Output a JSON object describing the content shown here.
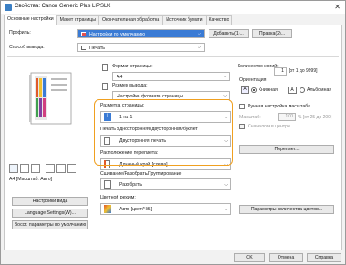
{
  "window": {
    "title": "Свойства: Canon Generic Plus LIPSLX",
    "close_glyph": "✕"
  },
  "tabs": [
    {
      "label": "Основные настройки"
    },
    {
      "label": "Макет страницы"
    },
    {
      "label": "Окончательная обработка"
    },
    {
      "label": "Источник бумаги"
    },
    {
      "label": "Качество"
    }
  ],
  "profile": {
    "label": "Профиль:",
    "value": "Настройки по умолчанию",
    "add_button": "Добавить(1)...",
    "edit_button": "Правка(2)..."
  },
  "output_method": {
    "label": "Способ вывода:",
    "value": "Печать"
  },
  "preview": {
    "caption": "A4 [Масштаб: Авто]"
  },
  "left_buttons": {
    "view_settings": "Настройки вида",
    "language": "Language Settings(W)...",
    "restore": "Восст. параметры по умолчанию"
  },
  "page_format": {
    "label": "Формат страницы:",
    "value": "A4"
  },
  "output_size": {
    "label": "Размер вывода:",
    "value": "Настройка формата страницы"
  },
  "copies": {
    "label": "Количество копий:",
    "value": "1",
    "range": "[от 1 до 9999]"
  },
  "orientation": {
    "label": "Ориентация",
    "portrait": "Книжная",
    "landscape": "Альбомная"
  },
  "manual_scale": {
    "label": "Ручная настройка масштаба",
    "scale_label": "Масштаб:",
    "scale_value": "100",
    "scale_range": "% [от 25 до 200]",
    "center_label": "Сначалом в центре"
  },
  "page_layout": {
    "label": "Разметка страницы:",
    "value": "1 на 1",
    "icon_num": "1"
  },
  "duplex": {
    "label": "Печать односторонняя/двусторонняя/буклет:",
    "value": "Двусторонняя печать"
  },
  "binding": {
    "label": "Расположение переплета:",
    "value": "Длинный край [слева]",
    "gutter_button": "Переплет..."
  },
  "collate": {
    "label": "Сшивание/Разобрать/Группирование",
    "value": "Разобрать"
  },
  "color_mode": {
    "label": "Цветной режим:",
    "value": "Авто [цвет/Ч/Б]",
    "count_button": "Параметры количества цветов..."
  },
  "footer": {
    "ok": "OK",
    "cancel": "Отмена",
    "help": "Справка"
  },
  "colors": {
    "highlight_border": "#f0a020",
    "select_highlight": "#3a7bd5"
  }
}
